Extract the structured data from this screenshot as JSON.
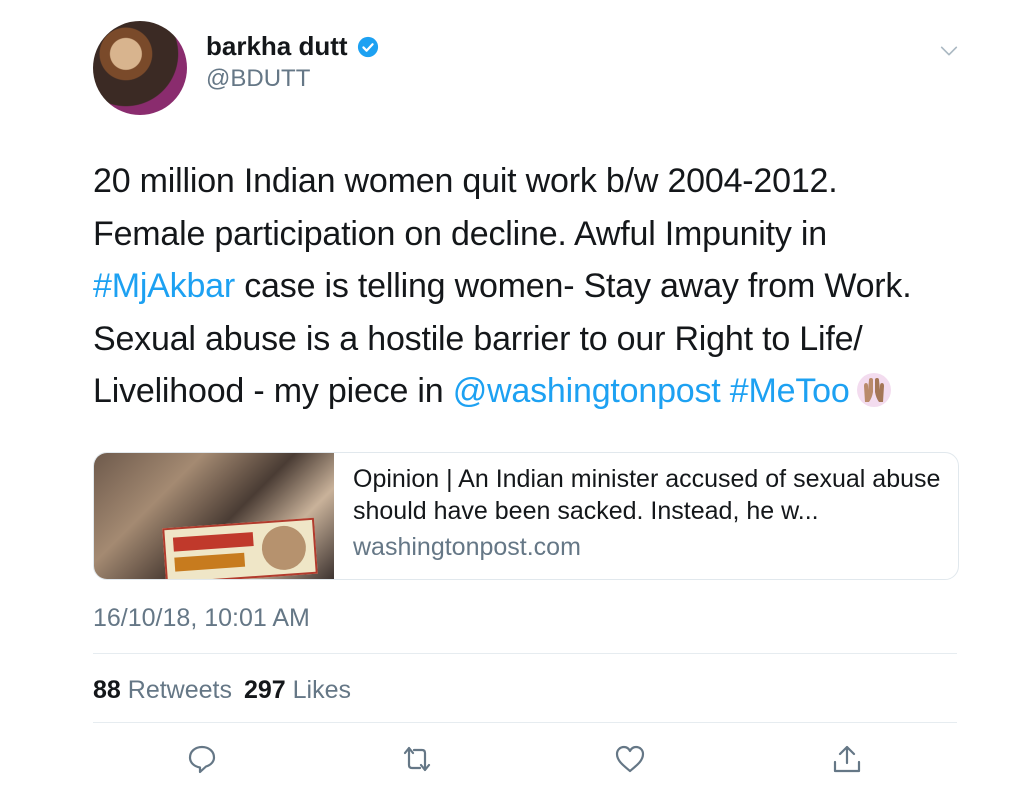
{
  "user": {
    "display_name": "barkha dutt",
    "handle": "@BDUTT",
    "verified": true
  },
  "tweet": {
    "lines": [
      [
        {
          "t": "20 million Indian women quit work b/w 2004-2012.",
          "link": false
        }
      ],
      [
        {
          "t": "Female participation on decline.  Awful Impunity in",
          "link": false
        }
      ],
      [
        {
          "t": "#MjAkbar",
          "link": true
        },
        {
          "t": " case is telling women- Stay away from Work.",
          "link": false
        }
      ],
      [
        {
          "t": "Sexual abuse is a hostile barrier to our Right to Life/",
          "link": false
        }
      ],
      [
        {
          "t": "Livelihood - my piece in ",
          "link": false
        },
        {
          "t": "@washingtonpost",
          "link": true
        },
        {
          "t": " ",
          "link": false
        },
        {
          "t": "#MeToo",
          "link": true
        }
      ]
    ],
    "emoji": "raised-hands-emoji"
  },
  "card": {
    "title": "Opinion | An Indian minister accused of sexual abuse should have been sacked. Instead, he w...",
    "domain": "washingtonpost.com"
  },
  "timestamp": "16/10/18, 10:01 AM",
  "stats": {
    "retweets_count": "88",
    "retweets_label": "Retweets",
    "likes_count": "297",
    "likes_label": "Likes"
  },
  "actions": [
    "reply-icon",
    "retweet-icon",
    "like-icon",
    "share-icon"
  ],
  "colors": {
    "link": "#1da1f2",
    "secondary_text": "#657786",
    "primary_text": "#14171a",
    "divider": "#e6ecf0"
  }
}
